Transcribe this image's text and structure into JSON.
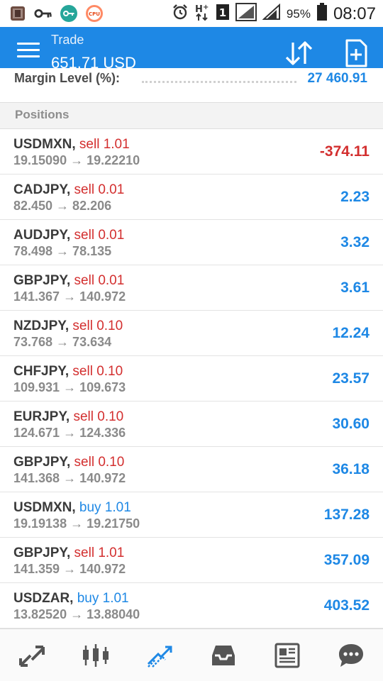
{
  "status_bar": {
    "battery_percent": "95%",
    "time": "08:07",
    "sim_indicator": "1"
  },
  "appbar": {
    "title": "Trade",
    "balance": "651.71 USD"
  },
  "margin": {
    "label": "Margin Level (%):",
    "value": "27 460.91"
  },
  "section": {
    "title": "Positions"
  },
  "positions": [
    {
      "symbol": "USDMXN",
      "type": "sell 1.01",
      "prices": "19.15090 → 19.22210",
      "profit": "-374.11"
    },
    {
      "symbol": "CADJPY",
      "type": "sell 0.01",
      "prices": "82.450 → 82.206",
      "profit": "2.23"
    },
    {
      "symbol": "AUDJPY",
      "type": "sell 0.01",
      "prices": "78.498 → 78.135",
      "profit": "3.32"
    },
    {
      "symbol": "GBPJPY",
      "type": "sell 0.01",
      "prices": "141.367 → 140.972",
      "profit": "3.61"
    },
    {
      "symbol": "NZDJPY",
      "type": "sell 0.10",
      "prices": "73.768 → 73.634",
      "profit": "12.24"
    },
    {
      "symbol": "CHFJPY",
      "type": "sell 0.10",
      "prices": "109.931 → 109.673",
      "profit": "23.57"
    },
    {
      "symbol": "EURJPY",
      "type": "sell 0.10",
      "prices": "124.671 → 124.336",
      "profit": "30.60"
    },
    {
      "symbol": "GBPJPY",
      "type": "sell 0.10",
      "prices": "141.368 → 140.972",
      "profit": "36.18"
    },
    {
      "symbol": "USDMXN",
      "type": "buy 1.01",
      "prices": "19.19138 → 19.21750",
      "profit": "137.28"
    },
    {
      "symbol": "GBPJPY",
      "type": "sell 1.01",
      "prices": "141.359 → 140.972",
      "profit": "357.09"
    },
    {
      "symbol": "USDZAR",
      "type": "buy 1.01",
      "prices": "13.82520 → 13.88040",
      "profit": "403.52"
    }
  ],
  "bottom_nav": [
    {
      "icon": "quotes-arrows-icon",
      "active": false
    },
    {
      "icon": "candlestick-chart-icon",
      "active": false
    },
    {
      "icon": "trade-trend-icon",
      "active": true
    },
    {
      "icon": "inbox-icon",
      "active": false
    },
    {
      "icon": "news-icon",
      "active": false
    },
    {
      "icon": "chat-icon",
      "active": false
    }
  ],
  "colors": {
    "accent": "#1e88e5",
    "loss": "#d32f2f",
    "sell": "#d32f2f",
    "buy": "#1e88e5",
    "nav_inactive": "#5a5a5a"
  }
}
